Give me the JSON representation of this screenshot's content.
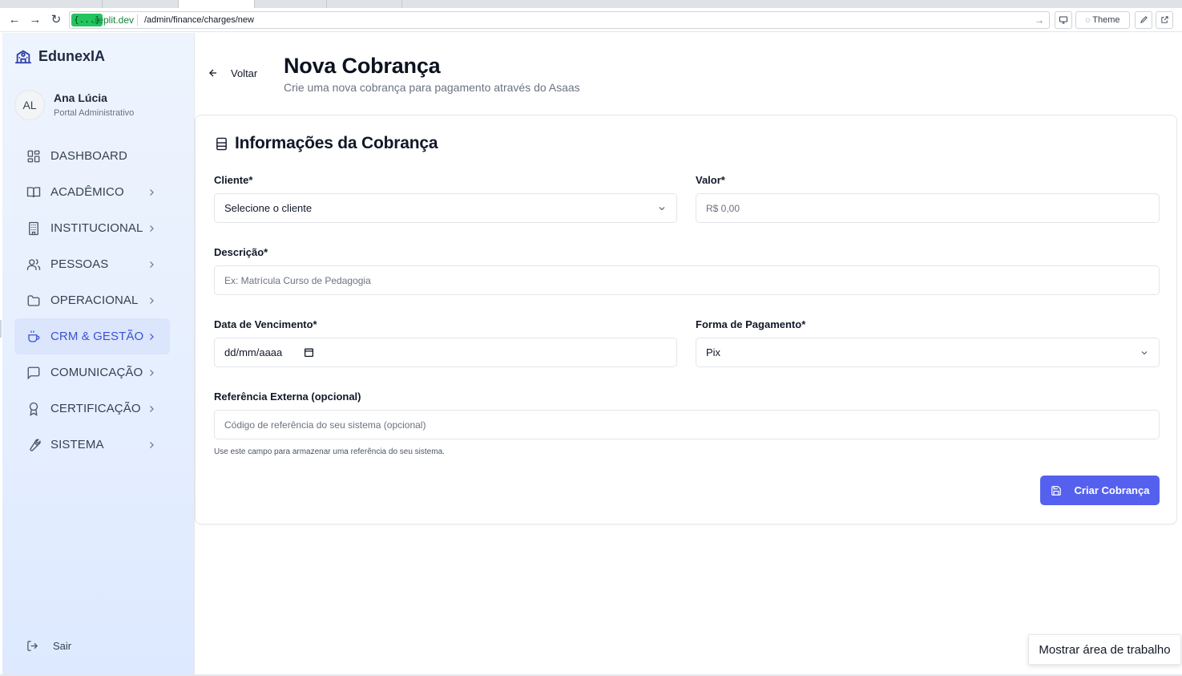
{
  "browser": {
    "url_badge": "{...}",
    "url_domain": ".replit.dev",
    "url_path": "/admin/finance/charges/new",
    "theme_label": "Theme",
    "go_icon": "arrow-right-icon"
  },
  "sidebar": {
    "brand": "EdunexIA",
    "user": {
      "initials": "AL",
      "name": "Ana Lúcia",
      "role": "Portal Administrativo"
    },
    "items": [
      {
        "label": "DASHBOARD",
        "icon": "grid-icon",
        "has_children": false,
        "active": false
      },
      {
        "label": "ACADÊMICO",
        "icon": "book-open-icon",
        "has_children": true,
        "active": false
      },
      {
        "label": "INSTITUCIONAL",
        "icon": "building-icon",
        "has_children": true,
        "active": false
      },
      {
        "label": "PESSOAS",
        "icon": "users-icon",
        "has_children": true,
        "active": false
      },
      {
        "label": "OPERACIONAL",
        "icon": "folder-icon",
        "has_children": true,
        "active": false
      },
      {
        "label": "CRM & GESTÃO",
        "icon": "coffee-icon",
        "has_children": true,
        "active": true
      },
      {
        "label": "COMUNICAÇÃO",
        "icon": "message-square-icon",
        "has_children": true,
        "active": false
      },
      {
        "label": "CERTIFICAÇÃO",
        "icon": "award-icon",
        "has_children": true,
        "active": false
      },
      {
        "label": "SISTEMA",
        "icon": "wrench-icon",
        "has_children": true,
        "active": false
      }
    ],
    "logout_label": "Sair"
  },
  "header": {
    "back_label": "Voltar",
    "title": "Nova Cobrança",
    "subtitle": "Crie uma nova cobrança para pagamento através do Asaas"
  },
  "form": {
    "card_title": "Informações da Cobrança",
    "cliente": {
      "label": "Cliente*",
      "value": "Selecione o cliente"
    },
    "valor": {
      "label": "Valor*",
      "placeholder": "R$ 0,00"
    },
    "descricao": {
      "label": "Descrição*",
      "placeholder": "Ex: Matrícula Curso de Pedagogia"
    },
    "vencimento": {
      "label": "Data de Vencimento*",
      "value": "dd/mm/aaaa"
    },
    "pagamento": {
      "label": "Forma de Pagamento*",
      "value": "Pix"
    },
    "referencia": {
      "label": "Referência Externa (opcional)",
      "placeholder": "Código de referência do seu sistema (opcional)",
      "help": "Use este campo para armazenar uma referência do seu sistema."
    },
    "submit_label": "Criar Cobrança"
  },
  "overlay": {
    "tooltip": "Mostrar área de trabalho"
  },
  "colors": {
    "accent": "#5561ee",
    "active_text": "#3b52d6",
    "active_bg": "#dbe5fb"
  }
}
